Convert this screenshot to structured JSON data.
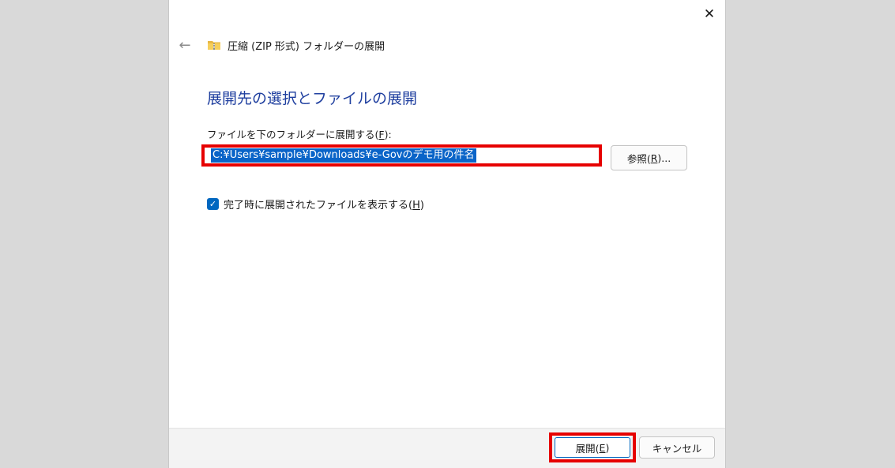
{
  "dialog": {
    "title": "圧縮 (ZIP 形式) フォルダーの展開",
    "heading": "展開先の選択とファイルの展開",
    "path_label_prefix": "ファイルを下のフォルダーに展開する(",
    "path_label_key": "F",
    "path_label_suffix": "):",
    "path_value": "C:¥Users¥sample¥Downloads¥e-Govのデモ用の件名",
    "browse_prefix": "参照(",
    "browse_key": "R",
    "browse_suffix": ")...",
    "checkbox_prefix": "完了時に展開されたファイルを表示する(",
    "checkbox_key": "H",
    "checkbox_suffix": ")",
    "checkbox_checked": true,
    "extract_prefix": "展開(",
    "extract_key": "E",
    "extract_suffix": ")",
    "cancel_label": "キャンセル"
  },
  "icons": {
    "close": "close-icon",
    "back": "back-arrow-icon",
    "zip": "zip-folder-icon",
    "check": "checkmark-icon"
  },
  "colors": {
    "heading": "#1f3f9f",
    "highlight": "#e60000",
    "selection": "#0a64c8",
    "accent": "#0067c0"
  }
}
